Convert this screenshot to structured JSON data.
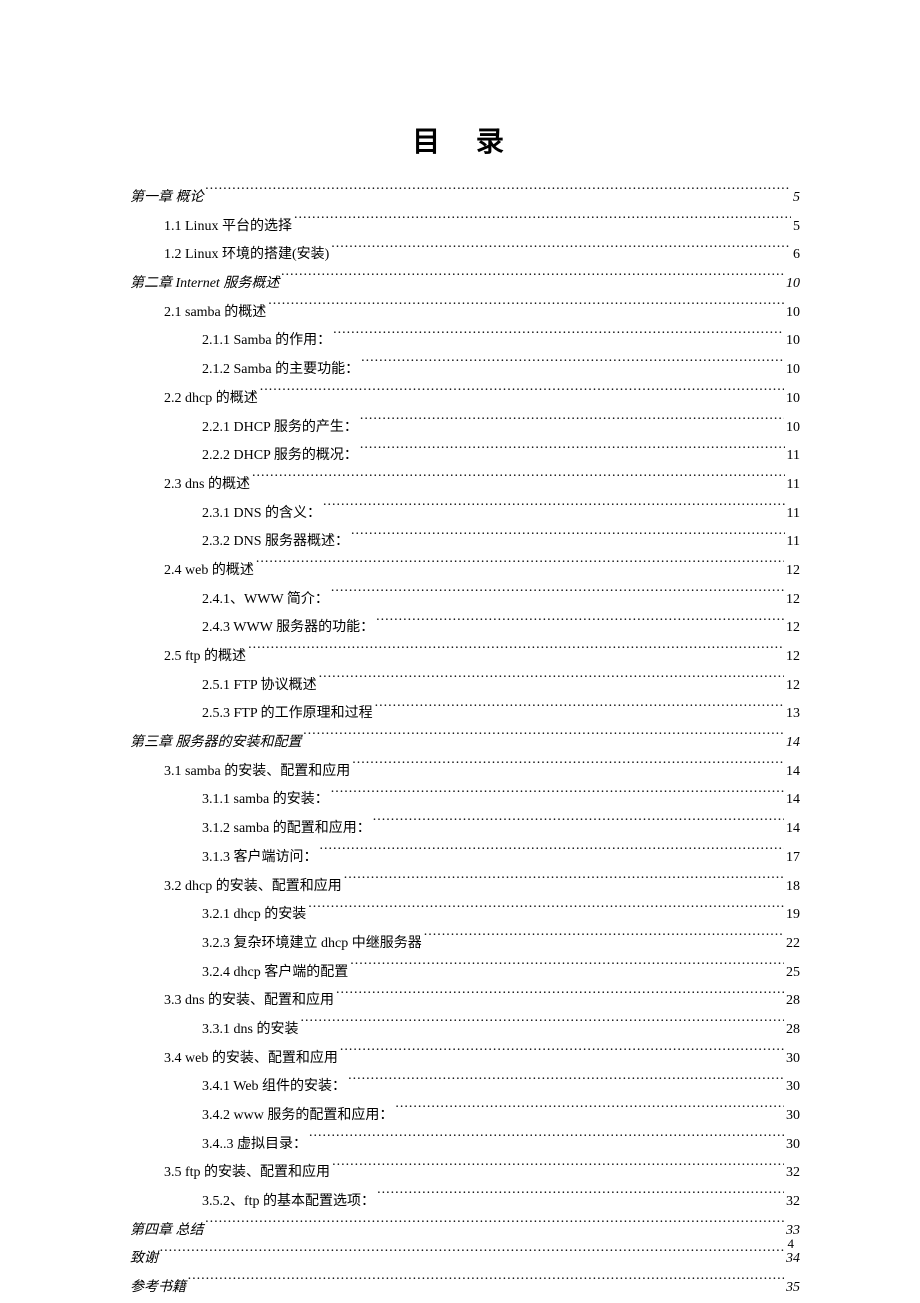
{
  "title": "目 录",
  "page_number": "4",
  "entries": [
    {
      "level": 0,
      "chapter": true,
      "label": "第一章  概论",
      "page": "5"
    },
    {
      "level": 1,
      "chapter": false,
      "label": "1.1 Linux 平台的选择",
      "page": "5"
    },
    {
      "level": 1,
      "chapter": false,
      "label": "1.2 Linux 环境的搭建(安装)",
      "page": "6"
    },
    {
      "level": 0,
      "chapter": true,
      "label": "第二章 Internet 服务概述",
      "page": "10"
    },
    {
      "level": 1,
      "chapter": false,
      "label": "2.1 samba 的概述",
      "page": "10"
    },
    {
      "level": 2,
      "chapter": false,
      "label": "2.1.1 Samba 的作用：",
      "page": "10"
    },
    {
      "level": 2,
      "chapter": false,
      "label": "2.1.2 Samba 的主要功能：",
      "page": "10"
    },
    {
      "level": 1,
      "chapter": false,
      "label": "2.2 dhcp 的概述",
      "page": "10"
    },
    {
      "level": 2,
      "chapter": false,
      "label": "2.2.1 DHCP 服务的产生：",
      "page": "10"
    },
    {
      "level": 2,
      "chapter": false,
      "label": "2.2.2 DHCP 服务的概况：",
      "page": "11"
    },
    {
      "level": 1,
      "chapter": false,
      "label": "2.3 dns 的概述",
      "page": "11"
    },
    {
      "level": 2,
      "chapter": false,
      "label": "2.3.1 DNS 的含义：",
      "page": "11"
    },
    {
      "level": 2,
      "chapter": false,
      "label": "2.3.2 DNS 服务器概述：",
      "page": "11"
    },
    {
      "level": 1,
      "chapter": false,
      "label": "2.4 web 的概述",
      "page": "12"
    },
    {
      "level": 2,
      "chapter": false,
      "label": "2.4.1、WWW 简介：",
      "page": "12"
    },
    {
      "level": 2,
      "chapter": false,
      "label": "2.4.3 WWW 服务器的功能：",
      "page": "12"
    },
    {
      "level": 1,
      "chapter": false,
      "label": "2.5 ftp 的概述",
      "page": "12"
    },
    {
      "level": 2,
      "chapter": false,
      "label": "2.5.1 FTP 协议概述",
      "page": "12"
    },
    {
      "level": 2,
      "chapter": false,
      "label": "2.5.3 FTP 的工作原理和过程",
      "page": "13"
    },
    {
      "level": 0,
      "chapter": true,
      "label": "第三章  服务器的安装和配置",
      "page": "14"
    },
    {
      "level": 1,
      "chapter": false,
      "label": "3.1 samba 的安装、配置和应用",
      "page": "14"
    },
    {
      "level": 2,
      "chapter": false,
      "label": "3.1.1 samba 的安装：",
      "page": "14"
    },
    {
      "level": 2,
      "chapter": false,
      "label": "3.1.2 samba 的配置和应用：",
      "page": "14"
    },
    {
      "level": 2,
      "chapter": false,
      "label": "3.1.3 客户端访问：",
      "page": "17"
    },
    {
      "level": 1,
      "chapter": false,
      "label": "3.2 dhcp 的安装、配置和应用",
      "page": "18"
    },
    {
      "level": 2,
      "chapter": false,
      "label": "3.2.1 dhcp 的安装",
      "page": "19"
    },
    {
      "level": 2,
      "chapter": false,
      "label": "3.2.3 复杂环境建立 dhcp 中继服务器",
      "page": "22"
    },
    {
      "level": 2,
      "chapter": false,
      "label": "3.2.4 dhcp 客户端的配置",
      "page": "25"
    },
    {
      "level": 1,
      "chapter": false,
      "label": "3.3 dns 的安装、配置和应用",
      "page": "28"
    },
    {
      "level": 2,
      "chapter": false,
      "label": "3.3.1 dns 的安装",
      "page": "28"
    },
    {
      "level": 1,
      "chapter": false,
      "label": "3.4 web 的安装、配置和应用",
      "page": "30"
    },
    {
      "level": 2,
      "chapter": false,
      "label": "3.4.1 Web 组件的安装：",
      "page": "30"
    },
    {
      "level": 2,
      "chapter": false,
      "label": "3.4.2 www 服务的配置和应用：",
      "page": "30"
    },
    {
      "level": 2,
      "chapter": false,
      "label": "3.4..3 虚拟目录：",
      "page": "30"
    },
    {
      "level": 1,
      "chapter": false,
      "label": "3.5 ftp 的安装、配置和应用",
      "page": "32"
    },
    {
      "level": 2,
      "chapter": false,
      "label": "3.5.2、ftp 的基本配置选项：",
      "page": "32"
    },
    {
      "level": 0,
      "chapter": true,
      "label": "第四章  总结",
      "page": "33"
    },
    {
      "level": 0,
      "chapter": true,
      "label": "致谢",
      "page": "34"
    },
    {
      "level": 0,
      "chapter": true,
      "label": "参考书籍",
      "page": "35"
    }
  ]
}
